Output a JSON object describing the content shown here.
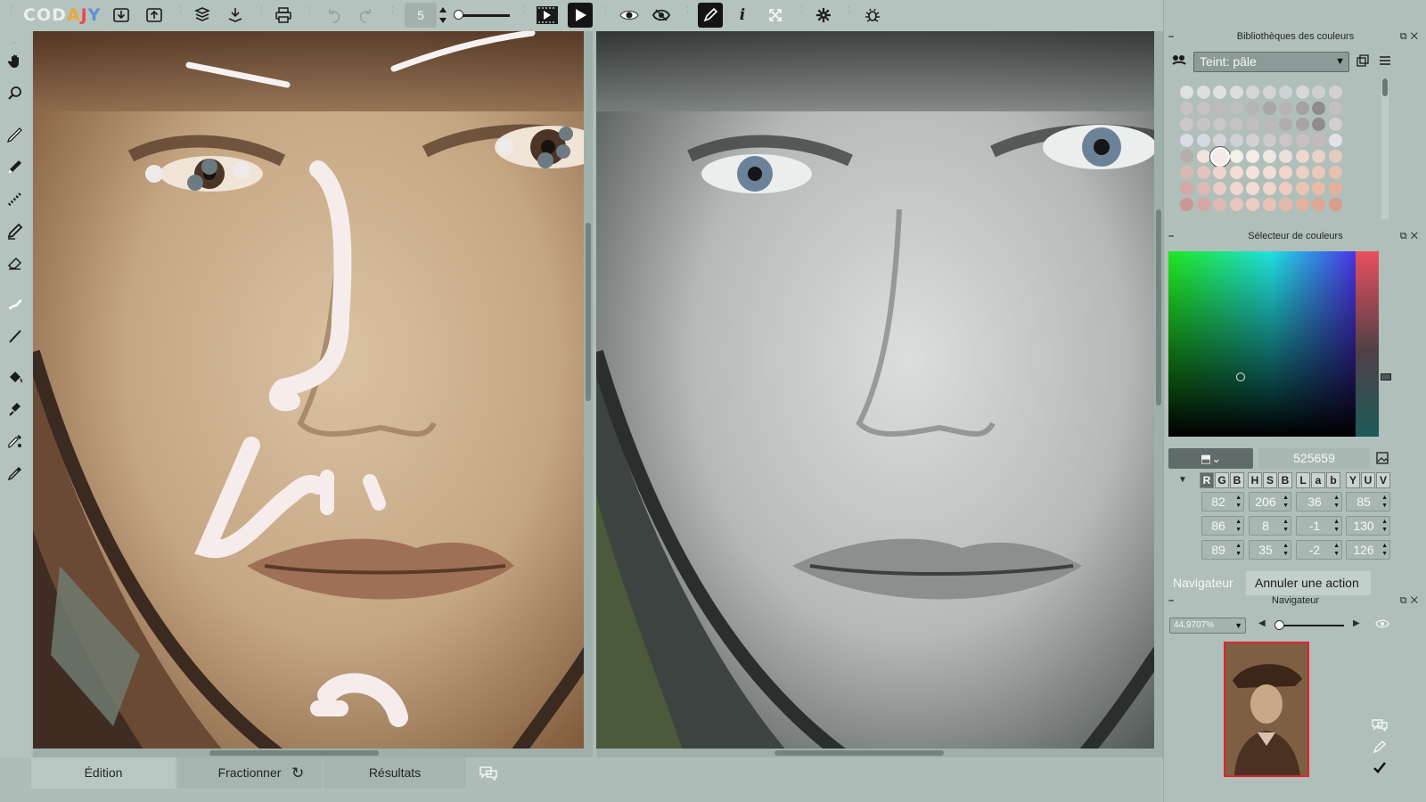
{
  "app": {
    "logo_letters": [
      "COD",
      "A",
      "J",
      "Y",
      "?"
    ],
    "logo_full": "CODAJY"
  },
  "toolbar": {
    "brush_size": "5",
    "icons": [
      "import-icon",
      "export-icon",
      "save-icon",
      "download-icon",
      "print-icon",
      "undo-icon",
      "redo-icon",
      "film-icon",
      "play-icon",
      "eye-icon",
      "mask-icon",
      "pen-icon",
      "info-icon",
      "fullscreen-icon",
      "settings-icon",
      "bug-icon"
    ]
  },
  "left_tools": [
    "hand-icon",
    "zoom-icon",
    "brush-icon",
    "pencil-icon",
    "dotted-brush-icon",
    "marker-icon",
    "eraser-icon",
    "smudge-icon",
    "line-icon",
    "fill-icon",
    "stamp-icon",
    "dropper-icon",
    "picker-icon"
  ],
  "bottom_tabs": {
    "edition": "Édition",
    "split": "Fractionner",
    "results": "Résultats"
  },
  "right_panel": {
    "libraries": {
      "title": "Bibliothèques des couleurs",
      "preset": "Teint: pâle"
    },
    "picker": {
      "title": "Sélecteur de couleurs",
      "hex": "525659",
      "modes": {
        "rgb": [
          "R",
          "G",
          "B"
        ],
        "hsb": [
          "H",
          "S",
          "B"
        ],
        "lab": [
          "L",
          "a",
          "b"
        ],
        "yuv": [
          "Y",
          "U",
          "V"
        ]
      },
      "values": {
        "rgb": [
          "82",
          "86",
          "89"
        ],
        "hsb": [
          "206",
          "8",
          "35"
        ],
        "lab": [
          "36",
          "-1",
          "-2"
        ],
        "yuv": [
          "85",
          "130",
          "126"
        ]
      }
    },
    "navigator": {
      "tab_navigator": "Navigateur",
      "tab_undo": "Annuler une action",
      "title": "Navigateur",
      "zoom": "44.9707%"
    }
  },
  "colors": {
    "accent_red": "#e0242c",
    "toolbar_bg": "#b4c3be",
    "panel_bg": "#b0bfba"
  }
}
